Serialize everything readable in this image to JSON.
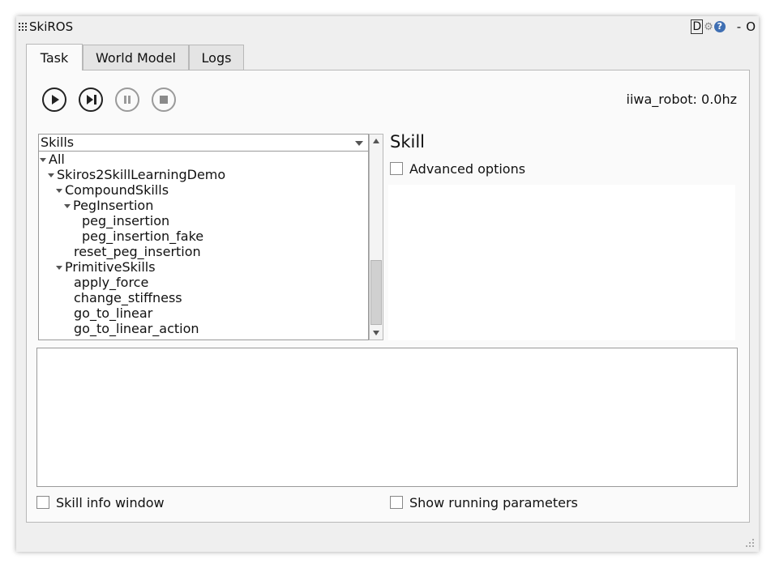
{
  "window": {
    "title": "SkiROS",
    "controls": {
      "d_label": "D",
      "settings_icon": "gear-icon",
      "help_label": "?",
      "minimize_label": "-",
      "close_label": "O"
    }
  },
  "tabs": [
    {
      "label": "Task",
      "active": true
    },
    {
      "label": "World Model",
      "active": false
    },
    {
      "label": "Logs",
      "active": false
    }
  ],
  "toolbar": {
    "buttons": [
      {
        "icon": "play-icon",
        "enabled": true
      },
      {
        "icon": "step-icon",
        "enabled": true
      },
      {
        "icon": "pause-icon",
        "enabled": false
      },
      {
        "icon": "stop-icon",
        "enabled": false
      }
    ],
    "robot_status": "iiwa_robot: 0.0hz"
  },
  "skills_panel": {
    "combo_value": "Skills",
    "tree": [
      {
        "label": "All",
        "expanded": true
      },
      {
        "label": "Skiros2SkillLearningDemo",
        "expanded": true
      },
      {
        "label": "CompoundSkills",
        "expanded": true
      },
      {
        "label": "PegInsertion",
        "expanded": true
      },
      {
        "label": "peg_insertion"
      },
      {
        "label": "peg_insertion_fake"
      },
      {
        "label": "reset_peg_insertion"
      },
      {
        "label": "PrimitiveSkills",
        "expanded": true
      },
      {
        "label": "apply_force"
      },
      {
        "label": "change_stiffness"
      },
      {
        "label": "go_to_linear"
      },
      {
        "label": "go_to_linear_action"
      }
    ]
  },
  "skill_panel": {
    "title": "Skill",
    "advanced_options_label": "Advanced options",
    "advanced_options_checked": false
  },
  "footer": {
    "skill_info_label": "Skill info window",
    "skill_info_checked": false,
    "show_params_label": "Show running parameters",
    "show_params_checked": false
  }
}
